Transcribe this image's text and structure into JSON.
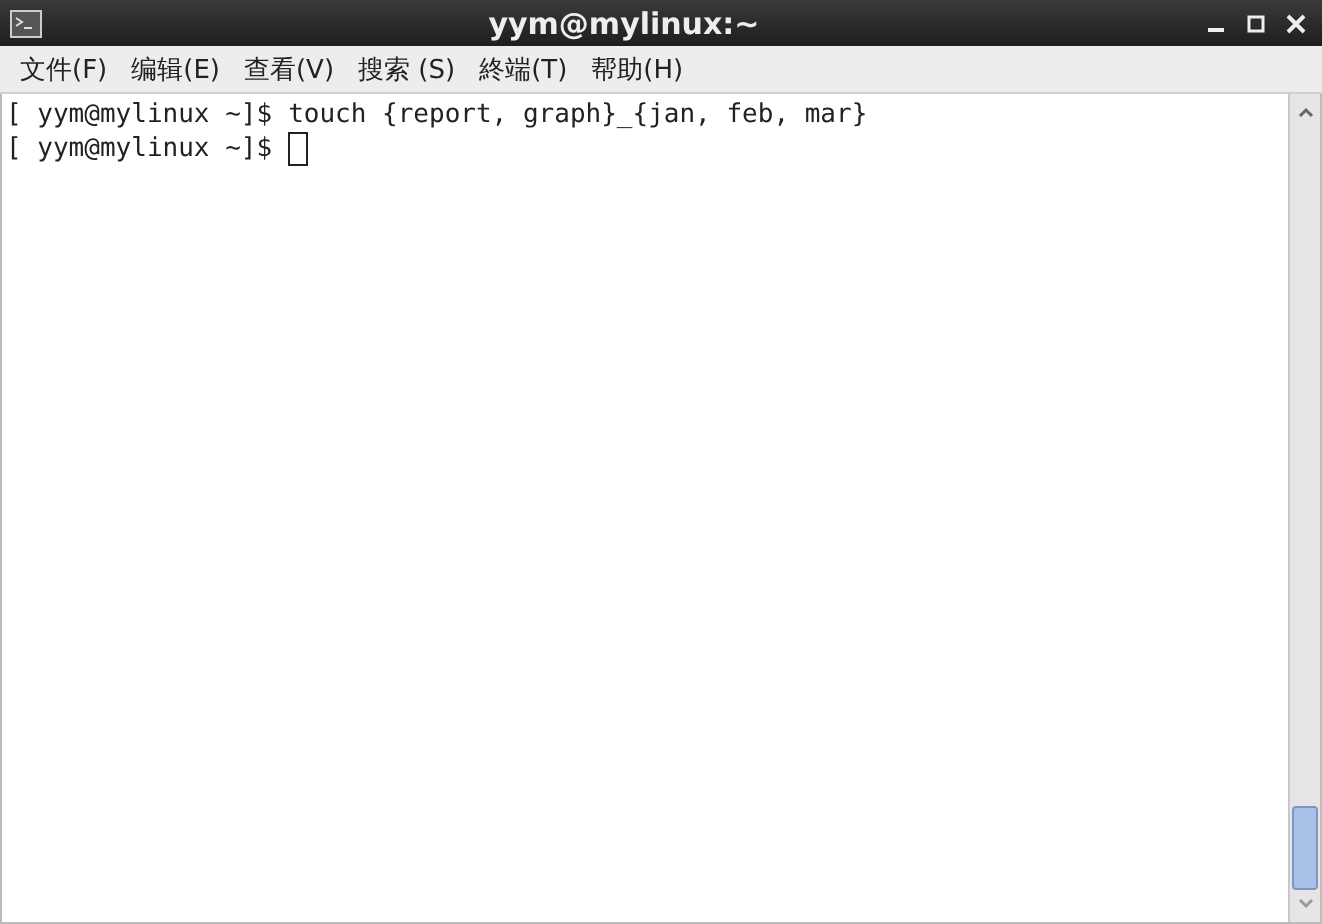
{
  "window": {
    "title": "yym@mylinux:~"
  },
  "menu": [
    {
      "label": "文件(F)"
    },
    {
      "label": "编辑(E)"
    },
    {
      "label": "查看(V)"
    },
    {
      "label": "搜索 (S)"
    },
    {
      "label": "終端(T)"
    },
    {
      "label": "帮助(H)"
    }
  ],
  "terminal": {
    "lines": [
      {
        "prompt": "[ yym@mylinux ~]$",
        "command": "touch {report, graph}_{jan, feb, mar}",
        "cursor": false
      },
      {
        "prompt": "[ yym@mylinux ~]$",
        "cursor": true
      }
    ]
  }
}
